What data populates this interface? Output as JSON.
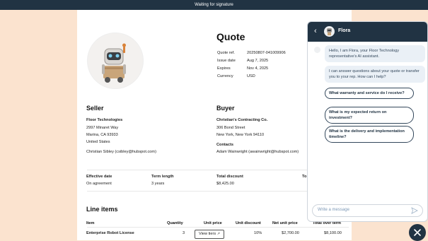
{
  "topbar": {
    "status": "Waiting for signature"
  },
  "quote": {
    "title": "Quote",
    "details": [
      {
        "label": "Quote ref.",
        "value": "20250807-041009906"
      },
      {
        "label": "Issue date",
        "value": "Aug 7, 2025"
      },
      {
        "label": "Expires",
        "value": "Nov 4, 2025"
      },
      {
        "label": "Currency",
        "value": "USD"
      }
    ]
  },
  "seller": {
    "heading": "Seller",
    "company": "Floor Technologies",
    "address1": "2997 Minaret Way",
    "address2": "Marina, CA 93933",
    "country": "United States",
    "contact": "Christian Sibley (csibley@hubspot.com)"
  },
  "buyer": {
    "heading": "Buyer",
    "company": "Christian's Contracting Co.",
    "address1": "306 Bond Street",
    "address2": "New York, New York 94110",
    "contacts_heading": "Contacts",
    "contact": "Adam Wainwright (awainwright@hubspot.com)"
  },
  "terms": {
    "effective_label": "Effective date",
    "effective_value": "On agreement",
    "term_label": "Term length",
    "term_value": "3 years",
    "discount_label": "Total discount",
    "discount_value": "$8,425.00",
    "cut_label": "To"
  },
  "line_items": {
    "heading": "Line items",
    "columns": [
      "Item",
      "Quantity",
      "Unit price",
      "Unit discount",
      "Net unit price",
      "Total over term"
    ],
    "rows": [
      {
        "item": "Enterprise Robot License",
        "quantity": "3",
        "unit_price": "View tiers",
        "unit_discount": "10%",
        "net_unit_price": "$2,700.00",
        "total": "$8,100.00"
      }
    ]
  },
  "chat": {
    "agent_name": "Flora",
    "messages": [
      "Hello, I am Flora, your Floor Technology representative's AI assistant.",
      "I can answer questions about your quote or transfer you to your rep. How can I help?"
    ],
    "options": [
      "What warranty and service do I receive?",
      "What is my expected return on investment?",
      "What is the delivery and implementation timeline?"
    ],
    "input_placeholder": "Write a message"
  },
  "icons": {
    "back": "chevron-left-icon",
    "send": "send-icon",
    "close": "close-icon",
    "external": "external-link-icon"
  },
  "colors": {
    "navy": "#213343",
    "peach": "#fbe3cf",
    "bubble": "#eaf0f6"
  }
}
